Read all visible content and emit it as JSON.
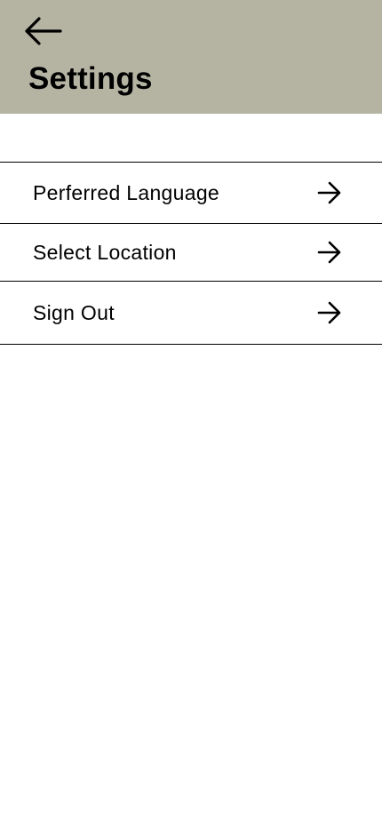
{
  "header": {
    "title": "Settings",
    "back_icon": "arrow-left-icon",
    "background_color": "#b5b4a3"
  },
  "menu": {
    "items": [
      {
        "label": "Perferred Language",
        "icon": "arrow-right-icon"
      },
      {
        "label": "Select Location",
        "icon": "arrow-right-icon"
      },
      {
        "label": "Sign Out",
        "icon": "arrow-right-icon"
      }
    ]
  }
}
